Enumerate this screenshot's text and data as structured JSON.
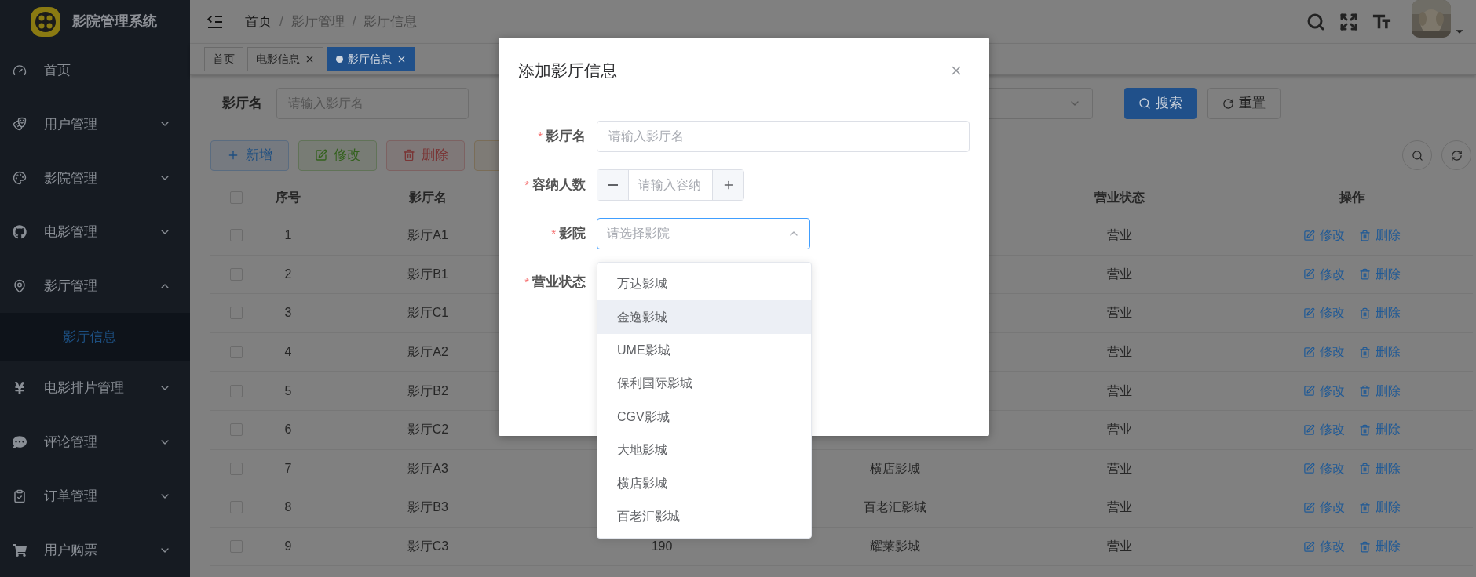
{
  "sidebar": {
    "title": "影院管理系统",
    "items": [
      {
        "label": "首页"
      },
      {
        "label": "用户管理",
        "expanded": false
      },
      {
        "label": "影院管理",
        "expanded": false
      },
      {
        "label": "电影管理",
        "expanded": false
      },
      {
        "label": "影厅管理",
        "expanded": true,
        "children": [
          {
            "label": "影厅信息",
            "selected": true
          }
        ]
      },
      {
        "label": "电影排片管理",
        "expanded": false
      },
      {
        "label": "评论管理",
        "expanded": false
      },
      {
        "label": "订单管理",
        "expanded": false
      },
      {
        "label": "用户购票",
        "expanded": false
      }
    ]
  },
  "header": {
    "breadcrumb": [
      "首页",
      "影厅管理",
      "影厅信息"
    ],
    "separator": "/"
  },
  "tags": [
    {
      "label": "首页",
      "closable": false,
      "selected": false
    },
    {
      "label": "电影信息",
      "closable": true,
      "selected": false
    },
    {
      "label": "影厅信息",
      "closable": true,
      "selected": true
    }
  ],
  "search": {
    "label": "影厅名",
    "placeholder": "请输入影厅名",
    "buttons": [
      {
        "label": "搜索",
        "kind": "primary"
      },
      {
        "label": "重置",
        "kind": "default"
      }
    ]
  },
  "toolbar": [
    {
      "label": "新增",
      "kind": "primary"
    },
    {
      "label": "修改",
      "kind": "success"
    },
    {
      "label": "删除",
      "kind": "danger"
    },
    {
      "kind": "warning"
    }
  ],
  "table": {
    "all_checked": false,
    "columns": [
      "序号",
      "影厅名",
      "营业状态",
      "操作"
    ],
    "rows": [
      {
        "checked": false,
        "no": "1",
        "name": "影厅A1",
        "status": "营业",
        "actions": [
          "修改",
          "删除"
        ]
      },
      {
        "checked": false,
        "no": "2",
        "name": "影厅B1",
        "status": "营业",
        "actions": [
          "修改",
          "删除"
        ]
      },
      {
        "checked": false,
        "no": "3",
        "name": "影厅C1",
        "status": "营业",
        "actions": [
          "修改",
          "删除"
        ]
      },
      {
        "checked": false,
        "no": "4",
        "name": "影厅A2",
        "status": "营业",
        "actions": [
          "修改",
          "删除"
        ]
      },
      {
        "checked": false,
        "no": "5",
        "name": "影厅B2",
        "status": "营业",
        "actions": [
          "修改",
          "删除"
        ]
      },
      {
        "checked": false,
        "no": "6",
        "name": "影厅C2",
        "status": "营业",
        "actions": [
          "修改",
          "删除"
        ]
      },
      {
        "checked": false,
        "no": "7",
        "name": "影厅A3",
        "column_4": "横店影城",
        "status": "营业",
        "actions": [
          "修改",
          "删除"
        ]
      },
      {
        "checked": false,
        "no": "8",
        "name": "影厅B3",
        "column_4": "百老汇影城",
        "status": "营业",
        "actions": [
          "修改",
          "删除"
        ]
      },
      {
        "checked": false,
        "no": "9",
        "name": "影厅C3",
        "column_3": "190",
        "column_4": "耀莱影城",
        "status": "营业",
        "actions": [
          "修改",
          "删除"
        ]
      }
    ]
  },
  "dialog": {
    "title": "添加影厅信息",
    "fields": [
      {
        "kind": "text",
        "mark": "*",
        "label": "影厅名",
        "placeholder": "请输入影厅名"
      },
      {
        "kind": "number",
        "mark": "*",
        "label": "容纳人数",
        "placeholder": "请输入容纳"
      },
      {
        "kind": "select",
        "mark": "*",
        "label": "影院",
        "placeholder": "请选择影院",
        "expanded": true
      },
      {
        "kind": "radio",
        "mark": "*",
        "label": "营业状态"
      }
    ]
  },
  "dropdown": [
    {
      "label": "万达影城",
      "hovered": false
    },
    {
      "label": "金逸影城",
      "hovered": true
    },
    {
      "label": "UME影城",
      "hovered": false
    },
    {
      "label": "保利国际影城",
      "hovered": false
    },
    {
      "label": "CGV影城",
      "hovered": false
    },
    {
      "label": "大地影城",
      "hovered": false
    },
    {
      "label": "横店影城",
      "hovered": false
    },
    {
      "label": "百老汇影城",
      "hovered": false
    }
  ]
}
